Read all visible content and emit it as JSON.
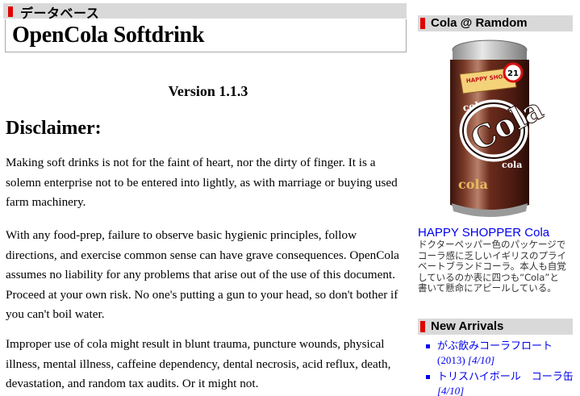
{
  "category_label": "データベース",
  "page_title": "OpenCola Softdrink",
  "version": "Version 1.1.3",
  "disclaimer_heading": "Disclaimer:",
  "paragraphs": [
    "Making soft drinks is not for the faint of heart, nor the dirty of finger. It is a solemn enterprise not to be entered into lightly, as with marriage or buying used farm machinery.",
    "With any food-prep, failure to observe basic hygienic principles, follow directions, and exercise common sense can have grave consequences. OpenCola assumes no liability for any problems that arise out of the use of this document. Proceed at your own risk. No one's putting a gun to your head, so don't bother if you can't boil water.",
    "Improper use of cola might result in blunt trauma, puncture wounds, physical illness, mental illness, caffeine dependency, dental necrosis, acid reflux, death, devastation, and random tax audits. Or it might not."
  ],
  "sidebar": {
    "random_heading": "Cola @ Ramdom",
    "can": {
      "brand_top": "HAPPY SHOPPER",
      "badge": "21",
      "logo_small_top": "cola",
      "logo_big": "Cola",
      "logo_small_mid": "cola",
      "logo_small_bottom": "cola"
    },
    "product_link": "HAPPY SHOPPER Cola",
    "product_desc": "ドクターペッパー色のパッケージでコーラ感に乏しいイギリスのプライベートブランドコーラ。本人も自覚しているのか表に四つも“Cola”と書いて懸命にアピールしている。",
    "arrivals_heading": "New Arrivals",
    "arrivals": [
      {
        "title": "がぶ飲みコーラフロート(2013)",
        "date": "[4/10]"
      },
      {
        "title": "トリスハイボール　コーラ缶",
        "date": "[4/10]"
      }
    ]
  },
  "colors": {
    "accent_red": "#e00000",
    "header_gray": "#d9d9d9",
    "link_blue": "#0000ee",
    "can_brown": "#5a2418"
  }
}
